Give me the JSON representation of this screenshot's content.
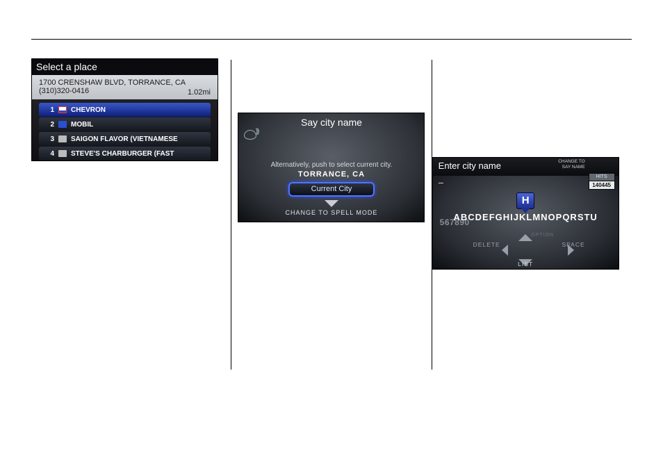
{
  "screen1": {
    "title": "Select a place",
    "address": "1700 CRENSHAW BLVD, TORRANCE, CA",
    "phone": "(310)320-0416",
    "distance": "1.02mi",
    "items": [
      {
        "num": "1",
        "name": "CHEVRON"
      },
      {
        "num": "2",
        "name": "MOBIL"
      },
      {
        "num": "3",
        "name": "SAIGON FLAVOR (VIETNAMESE"
      },
      {
        "num": "4",
        "name": "STEVE'S CHARBURGER (FAST"
      }
    ]
  },
  "screen2": {
    "title": "Say city name",
    "subtitle": "Alternatively, push to select current city.",
    "city": "TORRANCE, CA",
    "button": "Current City",
    "footer": "CHANGE TO SPELL MODE"
  },
  "screen3": {
    "title": "Enter city name",
    "change_to": "CHANGE TO\nSAY NAME",
    "hits_label": "HITS",
    "hits_value": "140445",
    "nums": "567890",
    "letters": "ABCDEFGHIJKLMNOPQRSTU",
    "highlight": "H",
    "delete": "DELETE",
    "option": "OPTION",
    "space": "SPACE",
    "list": "LIST"
  }
}
